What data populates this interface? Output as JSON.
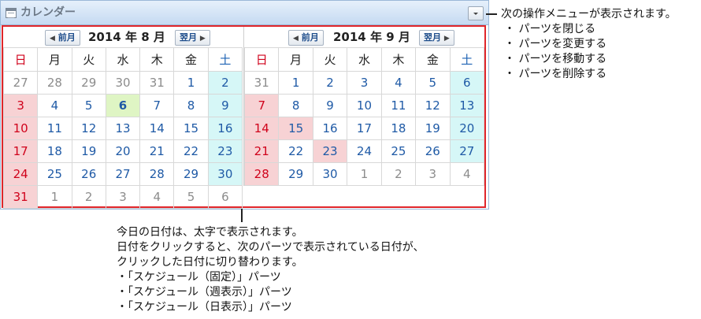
{
  "panel": {
    "title": "カレンダー",
    "menu_icon": "chevron-down-icon"
  },
  "months": [
    {
      "prev_label": "前月",
      "title": "2014 年 8 月",
      "next_label": "翌月",
      "weekdays": [
        "日",
        "月",
        "火",
        "水",
        "木",
        "金",
        "土"
      ],
      "weeks": [
        [
          {
            "d": "27",
            "o": 1
          },
          {
            "d": "28",
            "o": 1
          },
          {
            "d": "29",
            "o": 1
          },
          {
            "d": "30",
            "o": 1
          },
          {
            "d": "31",
            "o": 1
          },
          {
            "d": "1"
          },
          {
            "d": "2",
            "sat": 1
          }
        ],
        [
          {
            "d": "3",
            "sun": 1
          },
          {
            "d": "4"
          },
          {
            "d": "5"
          },
          {
            "d": "6",
            "today": 1
          },
          {
            "d": "7"
          },
          {
            "d": "8"
          },
          {
            "d": "9",
            "sat": 1
          }
        ],
        [
          {
            "d": "10",
            "sun": 1
          },
          {
            "d": "11"
          },
          {
            "d": "12"
          },
          {
            "d": "13"
          },
          {
            "d": "14"
          },
          {
            "d": "15"
          },
          {
            "d": "16",
            "sat": 1
          }
        ],
        [
          {
            "d": "17",
            "sun": 1
          },
          {
            "d": "18"
          },
          {
            "d": "19"
          },
          {
            "d": "20"
          },
          {
            "d": "21"
          },
          {
            "d": "22"
          },
          {
            "d": "23",
            "sat": 1
          }
        ],
        [
          {
            "d": "24",
            "sun": 1
          },
          {
            "d": "25"
          },
          {
            "d": "26"
          },
          {
            "d": "27"
          },
          {
            "d": "28"
          },
          {
            "d": "29"
          },
          {
            "d": "30",
            "sat": 1
          }
        ],
        [
          {
            "d": "31",
            "sun": 1
          },
          {
            "d": "1",
            "o": 1
          },
          {
            "d": "2",
            "o": 1
          },
          {
            "d": "3",
            "o": 1
          },
          {
            "d": "4",
            "o": 1
          },
          {
            "d": "5",
            "o": 1
          },
          {
            "d": "6",
            "o": 1
          }
        ]
      ]
    },
    {
      "prev_label": "前月",
      "title": "2014 年 9 月",
      "next_label": "翌月",
      "weekdays": [
        "日",
        "月",
        "火",
        "水",
        "木",
        "金",
        "土"
      ],
      "weeks": [
        [
          {
            "d": "31",
            "o": 1
          },
          {
            "d": "1"
          },
          {
            "d": "2"
          },
          {
            "d": "3"
          },
          {
            "d": "4"
          },
          {
            "d": "5"
          },
          {
            "d": "6",
            "sat": 1
          }
        ],
        [
          {
            "d": "7",
            "sun": 1
          },
          {
            "d": "8"
          },
          {
            "d": "9"
          },
          {
            "d": "10"
          },
          {
            "d": "11"
          },
          {
            "d": "12"
          },
          {
            "d": "13",
            "sat": 1
          }
        ],
        [
          {
            "d": "14",
            "sun": 1
          },
          {
            "d": "15",
            "hol": 1
          },
          {
            "d": "16"
          },
          {
            "d": "17"
          },
          {
            "d": "18"
          },
          {
            "d": "19"
          },
          {
            "d": "20",
            "sat": 1
          }
        ],
        [
          {
            "d": "21",
            "sun": 1
          },
          {
            "d": "22"
          },
          {
            "d": "23",
            "hol": 1
          },
          {
            "d": "24"
          },
          {
            "d": "25"
          },
          {
            "d": "26"
          },
          {
            "d": "27",
            "sat": 1
          }
        ],
        [
          {
            "d": "28",
            "sun": 1
          },
          {
            "d": "29"
          },
          {
            "d": "30"
          },
          {
            "d": "1",
            "o": 1
          },
          {
            "d": "2",
            "o": 1
          },
          {
            "d": "3",
            "o": 1
          },
          {
            "d": "4",
            "o": 1
          }
        ]
      ]
    }
  ],
  "notes": {
    "menu": {
      "heading": "次の操作メニューが表示されます。",
      "items": [
        "・ パーツを閉じる",
        "・ パーツを変更する",
        "・ パーツを移動する",
        "・ パーツを削除する"
      ]
    },
    "date": {
      "lines": [
        "今日の日付は、太字で表示されます。",
        "日付をクリックすると、次のパーツで表示されている日付が、",
        "クリックした日付に切り替わります。"
      ],
      "items": [
        "・「スケジュール（固定）」パーツ",
        "・「スケジュール（週表示）」パーツ",
        "・「スケジュール（日表示）」パーツ"
      ]
    }
  },
  "colors": {
    "highlight_frame": "#e0262b",
    "today_bg": "#dff5c4",
    "holiday_bg": "#f7d2d4",
    "saturday_bg": "#d6f7f7"
  }
}
